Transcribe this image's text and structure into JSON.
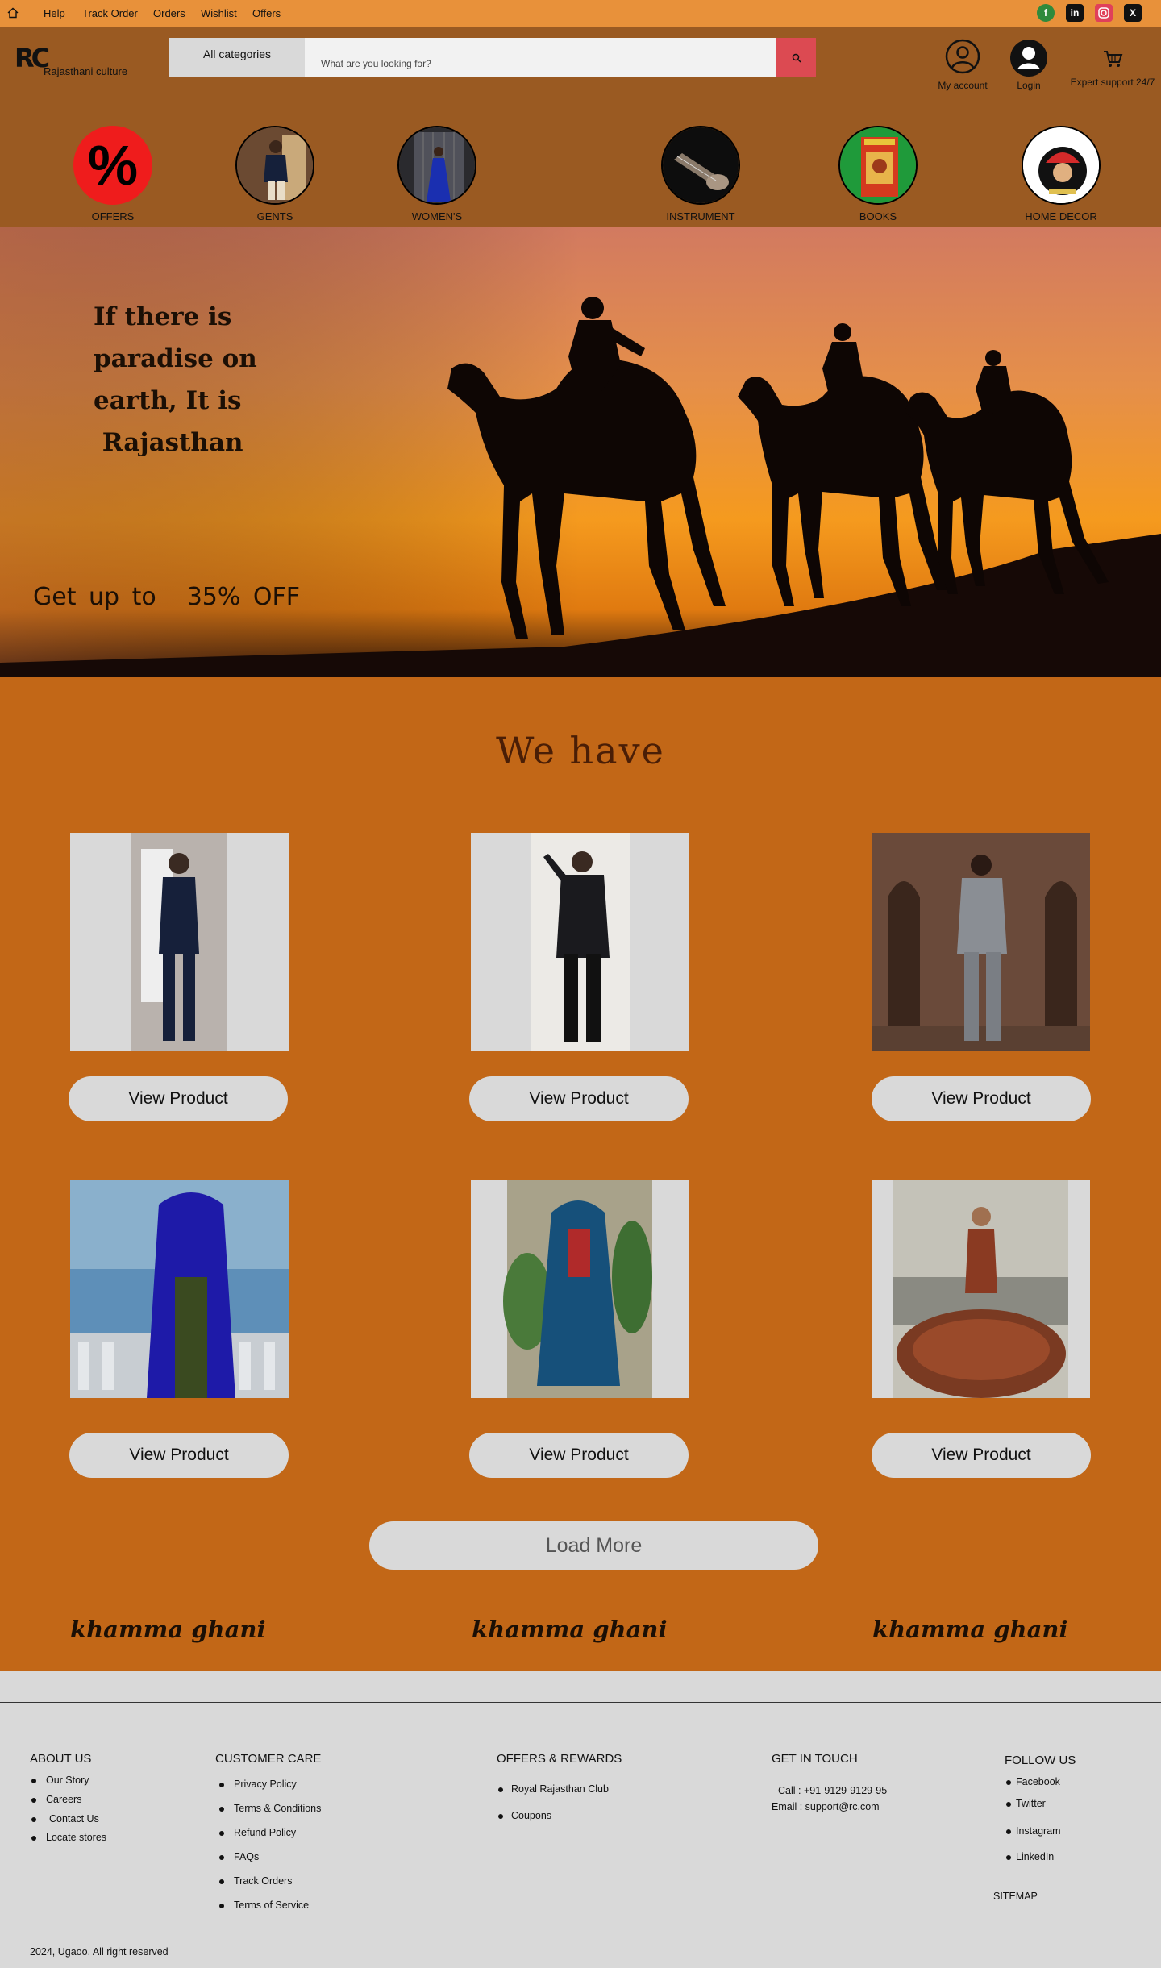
{
  "topbar": {
    "links": [
      "Help",
      "Track Order",
      "Orders",
      "Wishlist",
      "Offers"
    ]
  },
  "header": {
    "logo_mark": "RC",
    "logo_text": "Rajasthani culture",
    "category_button": "All categories",
    "search_placeholder": "What are you looking for?",
    "my_account": "My account",
    "login": "Login",
    "support": "Expert support 24/7"
  },
  "categories": [
    "OFFERS",
    "GENTS",
    "WOMEN'S",
    "INSTRUMENT",
    "BOOKS",
    "HOME DECOR"
  ],
  "hero": {
    "lines": [
      "If there is",
      "paradise on",
      "earth, It is",
      " Rajasthan"
    ],
    "offer_text": "Get up to",
    "offer_value": "35% OFF"
  },
  "main": {
    "title": "We have",
    "view_product_label": "View Product",
    "load_more_label": "Load More",
    "greeting": "khamma ghani"
  },
  "footer": {
    "about": {
      "title": "ABOUT US",
      "items": [
        "Our Story",
        "Careers",
        "Contact Us",
        "Locate stores"
      ]
    },
    "care": {
      "title": "CUSTOMER CARE",
      "items": [
        "Privacy Policy",
        "Terms & Conditions",
        "Refund Policy",
        "FAQs",
        "Track Orders",
        "Terms of Service"
      ]
    },
    "offers": {
      "title": "OFFERS & REWARDS",
      "items": [
        "Royal Rajasthan Club",
        "Coupons"
      ]
    },
    "contact": {
      "title": "GET IN TOUCH",
      "call": "Call : +91-9129-9129-95",
      "email": "Email : support@rc.com"
    },
    "follow": {
      "title": "FOLLOW US",
      "items": [
        "Facebook",
        "Twitter",
        "Instagram",
        "LinkedIn"
      ]
    },
    "sitemap": "SITEMAP",
    "copyright": "2024, Ugaoo. All right reserved"
  },
  "colors": {
    "topbar": "#e8913a",
    "header": "#9a5a22",
    "main_bg": "#c26717",
    "search_button": "#dc4a52",
    "footer": "#d9d9d9"
  }
}
